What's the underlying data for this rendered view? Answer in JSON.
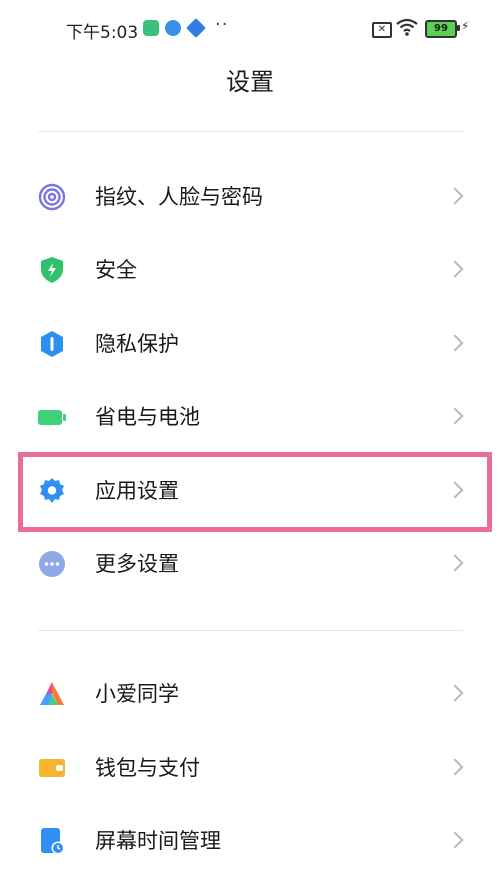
{
  "status_bar": {
    "time": "下午5:03",
    "overflow": "··",
    "battery_level": "99",
    "icons": [
      "shield-app-icon",
      "cloud-app-icon",
      "diamond-app-icon",
      "no-sim-icon",
      "wifi-icon",
      "battery-icon",
      "charging-icon"
    ]
  },
  "header": {
    "title": "设置"
  },
  "sections": [
    {
      "items": [
        {
          "label": "指纹、人脸与密码",
          "icon": "fingerprint-icon",
          "color": "#7b73e8"
        },
        {
          "label": "安全",
          "icon": "shield-bolt-icon",
          "color": "#2fc26b"
        },
        {
          "label": "隐私保护",
          "icon": "privacy-icon",
          "color": "#2d8ff0"
        },
        {
          "label": "省电与电池",
          "icon": "battery-saver-icon",
          "color": "#3fd17a"
        },
        {
          "label": "应用设置",
          "icon": "gear-icon",
          "color": "#2f8ff2",
          "highlighted": true
        },
        {
          "label": "更多设置",
          "icon": "more-dots-icon",
          "color": "#8fa8e8"
        }
      ]
    },
    {
      "items": [
        {
          "label": "小爱同学",
          "icon": "xiaoai-icon",
          "color": "#e94b8a"
        },
        {
          "label": "钱包与支付",
          "icon": "wallet-icon",
          "color": "#f5b52e"
        },
        {
          "label": "屏幕时间管理",
          "icon": "screen-time-icon",
          "color": "#2f8ff2"
        }
      ]
    }
  ],
  "highlight_color": "#ea6e97"
}
